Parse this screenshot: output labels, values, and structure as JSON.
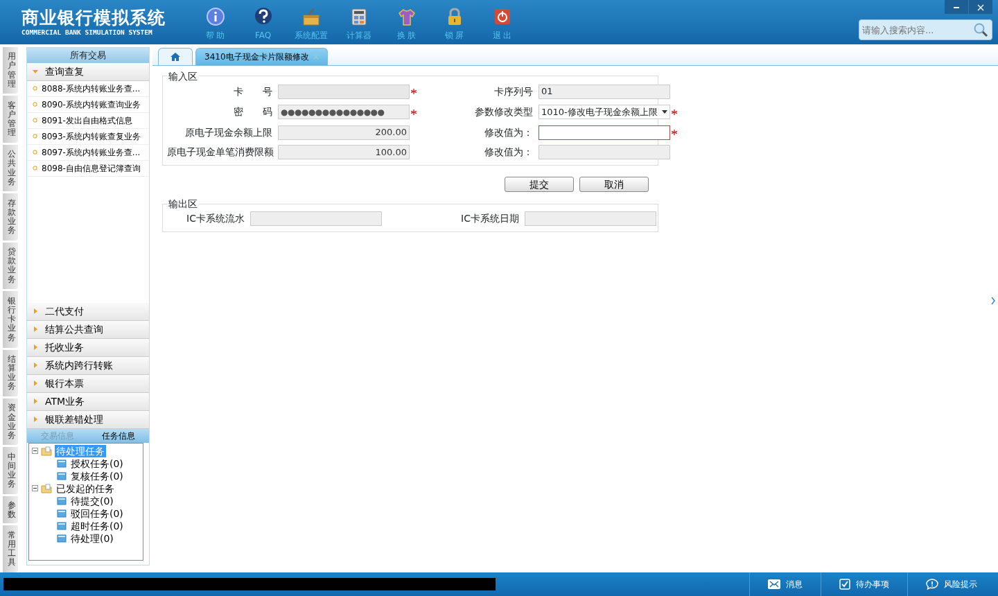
{
  "app": {
    "title": "商业银行模拟系统",
    "subtitle": "COMMERCIAL BANK SIMULATION SYSTEM"
  },
  "toolbar": [
    {
      "label": "帮 助",
      "kind": "info"
    },
    {
      "label": "FAQ",
      "kind": "faq"
    },
    {
      "label": "系统配置",
      "kind": "toolbox"
    },
    {
      "label": "计算器",
      "kind": "calculator"
    },
    {
      "label": "换 肤",
      "kind": "shirt"
    },
    {
      "label": "锁 屏",
      "kind": "lock"
    },
    {
      "label": "退 出",
      "kind": "power"
    }
  ],
  "search": {
    "placeholder": "请输入搜索内容..."
  },
  "side_tabs": [
    "用户管理",
    "客户管理",
    "公共业务",
    "存款业务",
    "贷款业务",
    "银行卡业务",
    "结算业务",
    "资金业务",
    "中间业务",
    "参数",
    "常用工具"
  ],
  "menu": {
    "title": "所有交易",
    "groups": [
      {
        "label": "查询查复",
        "expanded": true,
        "items": [
          "8088-系统内转账业务查...",
          "8090-系统内转账查询业务",
          "8091-发出自由格式信息",
          "8093-系统内转账查复业务",
          "8097-系统内转账业务查...",
          "8098-自由信息登记簿查询"
        ]
      },
      {
        "label": "二代支付",
        "expanded": false
      },
      {
        "label": "结算公共查询",
        "expanded": false
      },
      {
        "label": "托收业务",
        "expanded": false
      },
      {
        "label": "系统内跨行转账",
        "expanded": false
      },
      {
        "label": "银行本票",
        "expanded": false
      },
      {
        "label": "ATM业务",
        "expanded": false
      },
      {
        "label": "银联差错处理",
        "expanded": false
      }
    ]
  },
  "task_panel": {
    "tabs": [
      {
        "label": "交易信息",
        "selected": false
      },
      {
        "label": "任务信息",
        "selected": true
      }
    ],
    "tree": [
      {
        "label": "待处理任务",
        "selected": true,
        "children": [
          {
            "label": "授权任务(0)",
            "selected": false
          },
          {
            "label": "复核任务(0)",
            "selected": false
          }
        ]
      },
      {
        "label": "已发起的任务",
        "selected": false,
        "children": [
          {
            "label": "待提交(0)",
            "selected": false
          },
          {
            "label": "驳回任务(0)",
            "selected": false
          },
          {
            "label": "超时任务(0)",
            "selected": false
          },
          {
            "label": "待处理(0)",
            "selected": false
          }
        ]
      }
    ]
  },
  "tabs": [
    {
      "kind": "home",
      "selected": false
    },
    {
      "kind": "page",
      "label": "3410电子现金卡片限额修改",
      "selected": true
    }
  ],
  "input_section": {
    "title": "输入区",
    "fields": [
      {
        "label": "卡　　号",
        "kind": "blurred",
        "required": true,
        "invalid": false
      },
      {
        "label": "卡序列号",
        "kind": "text",
        "value": "01",
        "required": false,
        "invalid": false
      },
      {
        "label": "密　　码",
        "kind": "password",
        "value": "●●●●●●●●●●●●●●●",
        "required": true,
        "invalid": false
      },
      {
        "label": "参数修改类型",
        "kind": "select",
        "value": "1010-修改电子现金余额上限",
        "required": true,
        "invalid": false
      },
      {
        "label": "原电子现金余额上限",
        "kind": "amount",
        "value": "200.00",
        "required": false,
        "invalid": false
      },
      {
        "label": "修改值为：",
        "kind": "text",
        "required": true,
        "invalid": true
      },
      {
        "label": "原电子现金单笔消费限额",
        "kind": "amount",
        "value": "100.00",
        "required": false,
        "invalid": false
      },
      {
        "label": "修改值为：",
        "kind": "text",
        "required": false,
        "invalid": false
      }
    ]
  },
  "buttons": [
    "提交",
    "取消"
  ],
  "output_section": {
    "title": "输出区",
    "fields": [
      {
        "label": "IC卡系统流水"
      },
      {
        "label": "IC卡系统日期"
      }
    ]
  },
  "status_bar": [
    {
      "label": "消息",
      "kind": "mail"
    },
    {
      "label": "待办事项",
      "kind": "check"
    },
    {
      "label": "风险提示",
      "kind": "alert"
    }
  ]
}
